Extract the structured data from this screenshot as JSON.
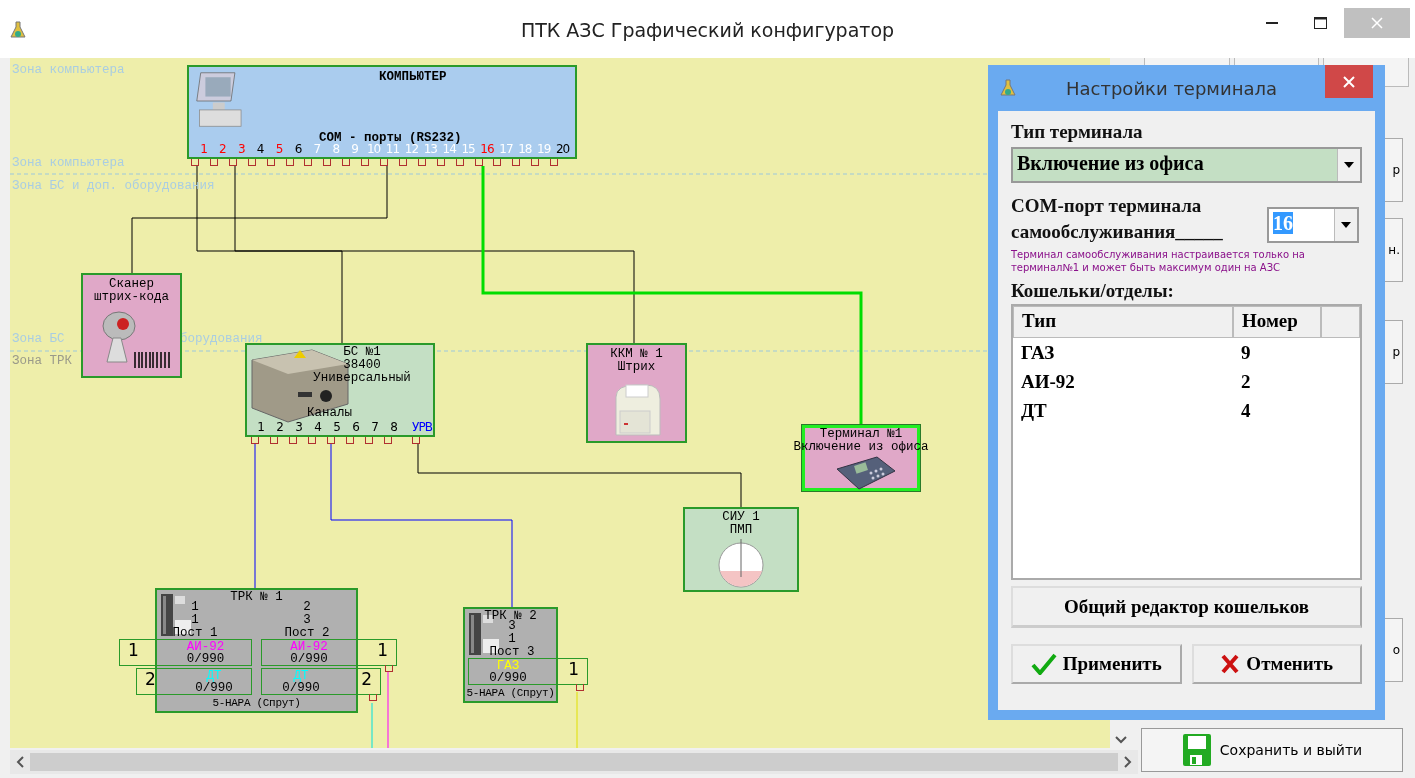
{
  "window": {
    "title": "ПТК АЗС Графический конфигуратор"
  },
  "zones": [
    {
      "label": "Зона компьютера"
    },
    {
      "label": "Зона компьютера"
    },
    {
      "label": "Зона БС и доп. оборудования"
    },
    {
      "label": "Зона БС"
    },
    {
      "label": "борудования"
    },
    {
      "label": "Зона ТРК"
    }
  ],
  "computer": {
    "title": "КОМПЬЮТЕР",
    "ports_label": "COM - порты (RS232)",
    "selected": false,
    "ports": [
      {
        "label": "1",
        "color": "#ff0000"
      },
      {
        "label": "2",
        "color": "#ff0000"
      },
      {
        "label": "3",
        "color": "#ff0000"
      },
      {
        "label": "4",
        "color": "#000000"
      },
      {
        "label": "5",
        "color": "#ff0000"
      },
      {
        "label": "6",
        "color": "#000000"
      },
      {
        "label": "7",
        "color": "#ffffff"
      },
      {
        "label": "8",
        "color": "#ffffff"
      },
      {
        "label": "9",
        "color": "#ffffff"
      },
      {
        "label": "10",
        "color": "#ffffff"
      },
      {
        "label": "11",
        "color": "#ffffff"
      },
      {
        "label": "12",
        "color": "#ffffff"
      },
      {
        "label": "13",
        "color": "#ffffff"
      },
      {
        "label": "14",
        "color": "#ffffff"
      },
      {
        "label": "15",
        "color": "#ffffff"
      },
      {
        "label": "16",
        "color": "#ff0000"
      },
      {
        "label": "17",
        "color": "#ffffff"
      },
      {
        "label": "18",
        "color": "#ffffff"
      },
      {
        "label": "19",
        "color": "#ffffff"
      },
      {
        "label": "20",
        "color": "#000000"
      }
    ]
  },
  "scanner": {
    "lines": [
      "Сканер",
      "штрих-кода"
    ],
    "selected": false
  },
  "bs": {
    "lines": [
      "БС №1",
      "38400",
      "Универсальный"
    ],
    "channels_label": "Каналы",
    "selected": false,
    "channels": [
      {
        "label": "1",
        "color": "#000000"
      },
      {
        "label": "2",
        "color": "#000000"
      },
      {
        "label": "3",
        "color": "#000000"
      },
      {
        "label": "4",
        "color": "#000000"
      },
      {
        "label": "5",
        "color": "#000000"
      },
      {
        "label": "6",
        "color": "#000000"
      },
      {
        "label": "7",
        "color": "#000000"
      },
      {
        "label": "8",
        "color": "#000000"
      },
      {
        "label": "УРВ",
        "color": "#0000ff"
      }
    ]
  },
  "kkm": {
    "lines": [
      "ККМ № 1",
      "Штрих"
    ],
    "selected": false
  },
  "terminal": {
    "lines": [
      "Терминал №1",
      "Включение из офиса"
    ],
    "selected": true
  },
  "siu": {
    "lines": [
      "СИУ 1",
      "ПМП"
    ],
    "selected": false
  },
  "dispensers": [
    {
      "title": "ТРК № 1",
      "model": "5-НАРА (Спрут)",
      "posts": [
        {
          "numbers": [
            "1",
            "1"
          ],
          "label": "Пост 1",
          "nozzles": [
            {
              "number": "1",
              "fuel": "АИ-92",
              "color": "#ff00ff",
              "volume": "0/990"
            },
            {
              "number": "2",
              "fuel": "ДТ",
              "color": "#00ffff",
              "volume": "0/990"
            }
          ]
        },
        {
          "numbers": [
            "2",
            "3"
          ],
          "label": "Пост 2",
          "nozzles": [
            {
              "number": "1",
              "fuel": "АИ-92",
              "color": "#ff00ff",
              "volume": "0/990"
            },
            {
              "number": "2",
              "fuel": "ДТ",
              "color": "#00ffff",
              "volume": "0/990"
            }
          ]
        }
      ]
    },
    {
      "title": "ТРК № 2",
      "model": "5-НАРА (Спрут)",
      "posts": [
        {
          "numbers": [
            "3",
            "1"
          ],
          "label": "Пост 3",
          "nozzles": [
            {
              "number": "1",
              "fuel": "ГАЗ",
              "color": "#ffff00",
              "volume": "0/990"
            }
          ]
        }
      ]
    }
  ],
  "side_buttons": [
    {
      "label": "р"
    },
    {
      "label": "н."
    },
    {
      "label": "р"
    },
    {
      "label": "о"
    }
  ],
  "save_button": {
    "label": "Сохранить и выйти"
  },
  "dialog": {
    "title": "Настройки терминала",
    "type_label": "Тип терминала",
    "type_value": "Включение из офиса",
    "port_label_1": "COM-порт терминала",
    "port_label_2": "самообслуживания_____",
    "port_value": "16",
    "note": "Терминал самообслуживания настраивается только на терминал№1 и может быть максимум один на АЗС",
    "wallets_label": "Кошельки/отделы:",
    "columns": [
      "Тип",
      "Номер"
    ],
    "rows": [
      [
        "ГАЗ",
        "9"
      ],
      [
        "АИ-92",
        "2"
      ],
      [
        "ДТ",
        "4"
      ]
    ],
    "editor_button": "Общий редактор кошельков",
    "apply_button": "Применить",
    "cancel_button": "Отменить"
  }
}
